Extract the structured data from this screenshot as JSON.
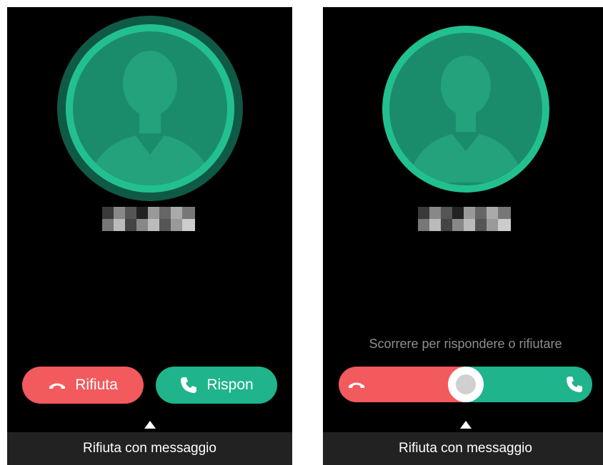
{
  "colors": {
    "reject": "#f25a5d",
    "answer": "#1fb48b",
    "avatar_fill": "#1a8c6c",
    "avatar_ring": "#23c08f",
    "background": "#000000",
    "message_bar": "#222222"
  },
  "left_screen": {
    "caller_avatar_icon": "person-silhouette-icon",
    "reject_button": {
      "label": "Rifiuta",
      "icon": "hang-up-icon"
    },
    "answer_button": {
      "label": "Rispon",
      "icon": "phone-icon"
    },
    "message_bar": {
      "label": "Rifiuta con messaggio",
      "icon": "up-arrow-icon"
    }
  },
  "right_screen": {
    "caller_avatar_icon": "person-silhouette-icon",
    "hint": "Scorrere per rispondere o rifiutare",
    "slider": {
      "left_icon": "hang-up-icon",
      "right_icon": "phone-icon",
      "knob_icon": "slider-knob"
    },
    "message_bar": {
      "label": "Rifiuta con messaggio",
      "icon": "up-arrow-icon"
    }
  }
}
